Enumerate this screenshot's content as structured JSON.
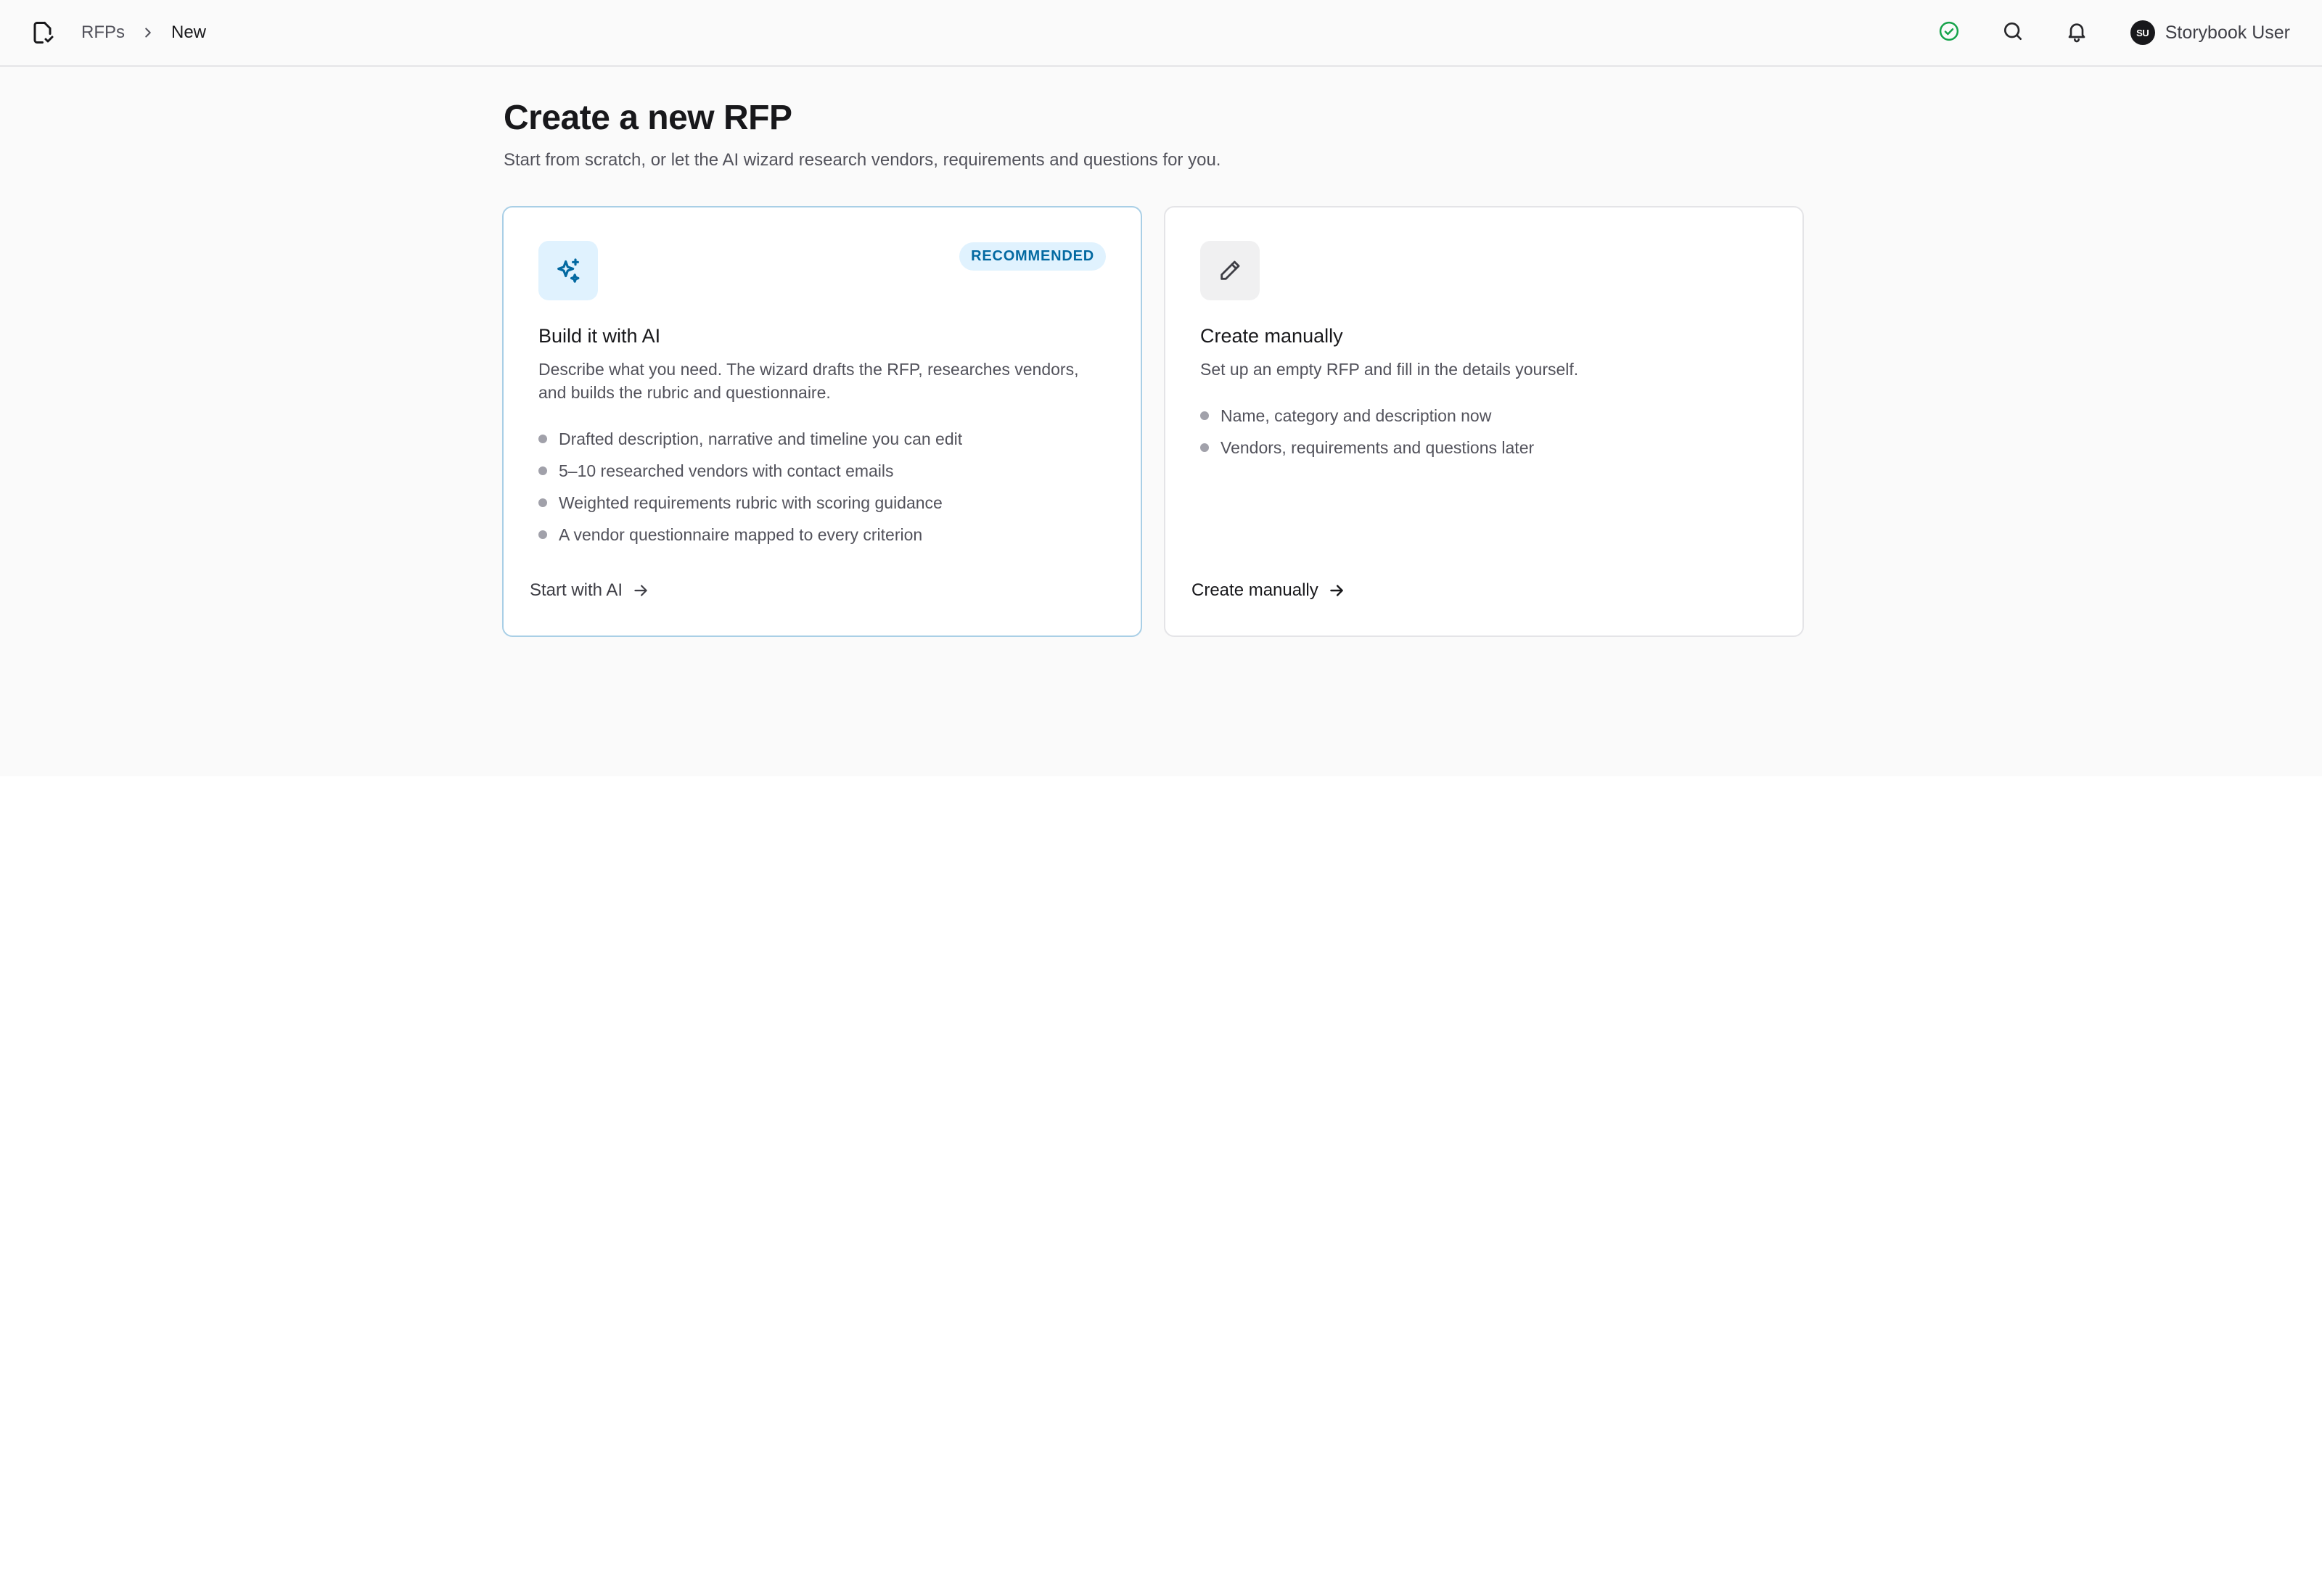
{
  "header": {
    "breadcrumb": [
      "RFPs",
      "New"
    ],
    "user": {
      "initials": "SU",
      "name": "Storybook User"
    },
    "icons": {
      "logo": "file-check-icon",
      "status": "check-circle-icon",
      "search": "search-icon",
      "notifications": "bell-icon"
    }
  },
  "page": {
    "title": "Create a new RFP",
    "subtitle": "Start from scratch, or let the AI wizard research vendors, requirements and questions for you."
  },
  "cards": [
    {
      "id": "ai",
      "icon": "sparkles-icon",
      "badge": "RECOMMENDED",
      "title": "Build it with AI",
      "description": "Describe what you need. The wizard drafts the RFP, researches vendors, and builds the rubric and questionnaire.",
      "features": [
        "Drafted description, narrative and timeline you can edit",
        "5–10 researched vendors with contact emails",
        "Weighted requirements rubric with scoring guidance",
        "A vendor questionnaire mapped to every criterion"
      ],
      "cta": "Start with AI"
    },
    {
      "id": "manual",
      "icon": "pencil-icon",
      "title": "Create manually",
      "description": "Set up an empty RFP and fill in the details yourself.",
      "features": [
        "Name, category and description now",
        "Vendors, requirements and questions later"
      ],
      "cta": "Create manually"
    }
  ],
  "colors": {
    "accent": "#0369a1",
    "accent_bg": "#e0f2fe",
    "status_ok": "#16a34a",
    "background": "#fafafa"
  }
}
